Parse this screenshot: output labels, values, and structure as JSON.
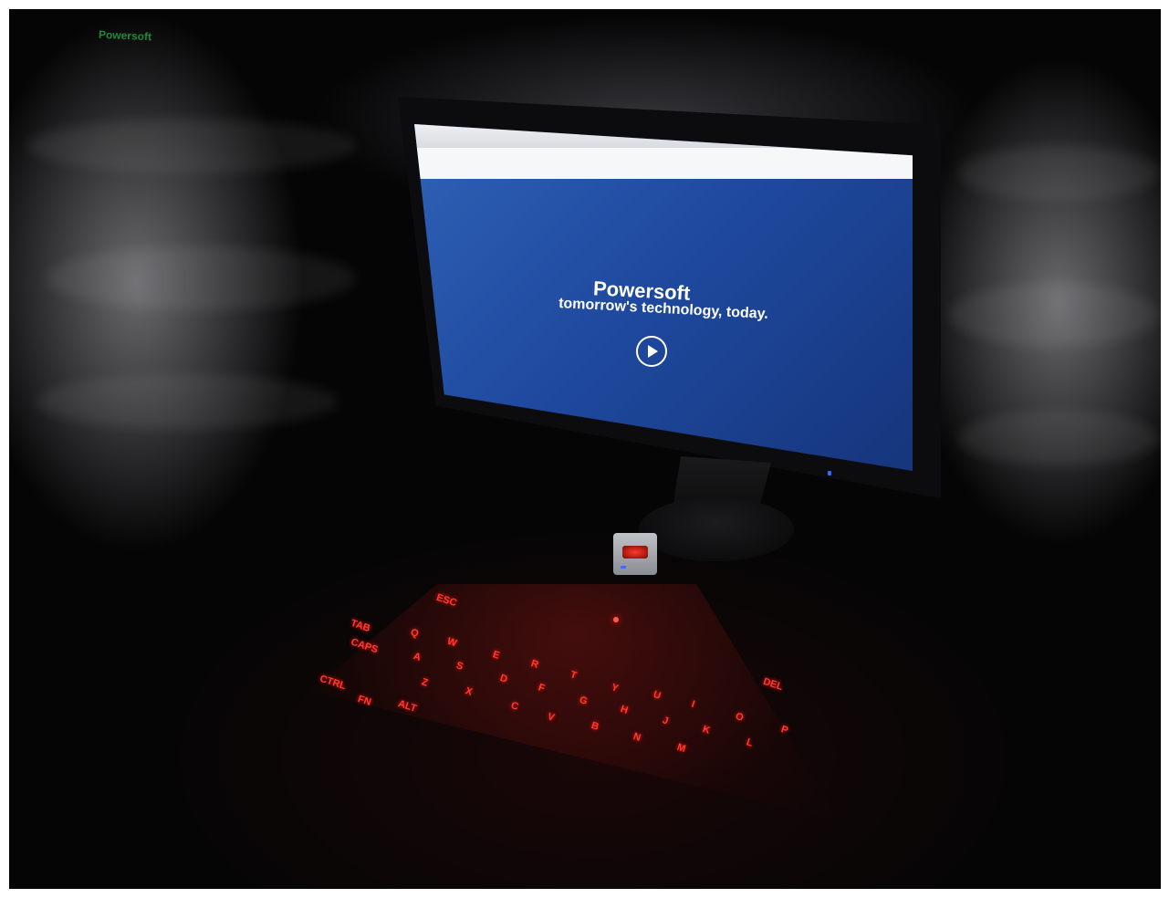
{
  "photo": {
    "description_free": true
  },
  "screen": {
    "logo": "Powersoft",
    "hero_title": "Powersoft",
    "hero_subtitle": "tomorrow's technology, today."
  },
  "keyboard": {
    "keys": [
      "ESC",
      "TAB",
      "CAPS",
      "CTRL",
      "FN",
      "ALT",
      "Q",
      "A",
      "Z",
      "W",
      "S",
      "X",
      "E",
      "D",
      "C",
      "R",
      "F",
      "V",
      "T",
      "G",
      "B",
      "Y",
      "H",
      "N",
      "U",
      "J",
      "M",
      "I",
      "K",
      "O",
      "L",
      "P",
      "DEL"
    ]
  },
  "colors": {
    "laser": "#ff3b2f",
    "screen_blue": "#2f62b6",
    "logo_green": "#1f8a3a"
  }
}
